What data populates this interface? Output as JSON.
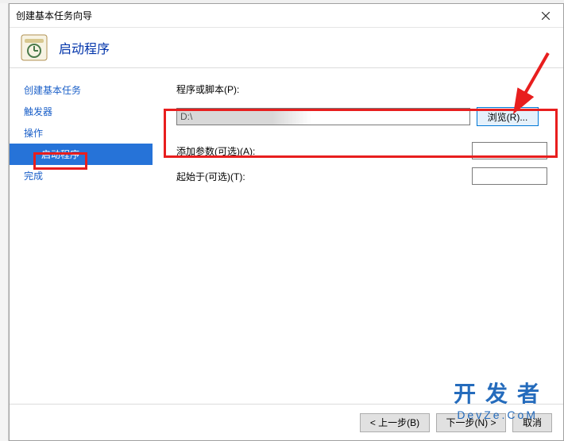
{
  "window": {
    "title": "创建基本任务向导"
  },
  "header": {
    "title": "启动程序"
  },
  "sidebar": {
    "items": [
      {
        "label": "创建基本任务",
        "indent": false,
        "selected": false
      },
      {
        "label": "触发器",
        "indent": false,
        "selected": false
      },
      {
        "label": "操作",
        "indent": false,
        "selected": false
      },
      {
        "label": "启动程序",
        "indent": true,
        "selected": true
      },
      {
        "label": "完成",
        "indent": false,
        "selected": false
      }
    ]
  },
  "form": {
    "program_label": "程序或脚本(P):",
    "program_value": "D:\\",
    "browse_label": "浏览(R)...",
    "args_label": "添加参数(可选)(A):",
    "args_value": "",
    "startin_label": "起始于(可选)(T):",
    "startin_value": ""
  },
  "buttons": {
    "back": "< 上一步(B)",
    "next": "下一步(N) >",
    "cancel": "取消"
  },
  "watermark": {
    "main": "开发者",
    "sub": "DevZe.CoM"
  }
}
